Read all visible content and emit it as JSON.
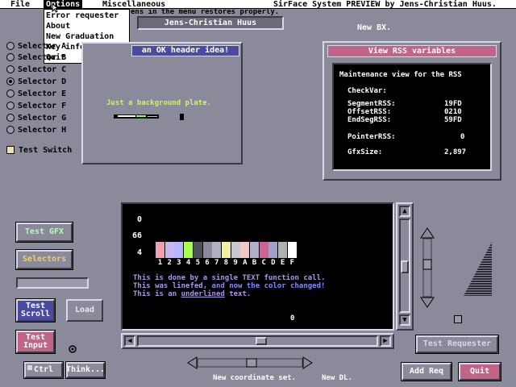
{
  "menubar": {
    "file": "File",
    "options": "Options",
    "misc": "Miscellaneous",
    "title": "SirFace System PREVIEW by Jens-Christian Huus."
  },
  "options_menu": {
    "items": [
      "Error requester",
      "About",
      "New Graduation",
      "Key information",
      "Quit"
    ]
  },
  "hidden_text": "ens in the menu restores properly.",
  "name_banner": "Jens-Christian Huus",
  "new_bx": "New BX.",
  "selectors": [
    {
      "label": "Selector A",
      "selected": false
    },
    {
      "label": "Selector B",
      "selected": false
    },
    {
      "label": "Selector C",
      "selected": false
    },
    {
      "label": "Selector D",
      "selected": true
    },
    {
      "label": "Selector E",
      "selected": false
    },
    {
      "label": "Selector F",
      "selected": false
    },
    {
      "label": "Selector G",
      "selected": false
    },
    {
      "label": "Selector H",
      "selected": false
    }
  ],
  "test_switch": "Test Switch",
  "ok_window": {
    "title": "an OK header idea!",
    "text": "Just a background plate."
  },
  "rss_window": {
    "title": "View RSS variables",
    "heading": "Maintenance view for the RSS",
    "checkvar": "CheckVar:",
    "rows": [
      {
        "label": "SegmentRSS:",
        "value": "19FD"
      },
      {
        "label": "OffsetRSS:",
        "value": "0210"
      },
      {
        "label": "EndSegRSS:",
        "value": "59FD"
      },
      {
        "label": "PointerRSS:",
        "value": "0"
      },
      {
        "label": "GfxSize:",
        "value": "2,897"
      }
    ]
  },
  "buttons": {
    "test_gfx": "Test GFX",
    "selectors": "Selectors",
    "test_scroll_1": "Test",
    "test_scroll_2": "Scroll",
    "load": "Load",
    "test_input_1": "Test",
    "test_input_2": "Input",
    "ctrl": "Ctrl",
    "think": "Think...",
    "test_requester": "Test Requester",
    "add_req": "Add Req",
    "quit": "Quit"
  },
  "text_area": {
    "num_0": "0",
    "num_66": "66",
    "num_4": "4",
    "palette_labels": [
      "1",
      "2",
      "3",
      "4",
      "5",
      "6",
      "7",
      "8",
      "9",
      "A",
      "B",
      "C",
      "D",
      "E",
      "F"
    ],
    "palette_colors": [
      "#f0a0b0",
      "#c8b4f0",
      "#b4b4ff",
      "#a8ff50",
      "#50505a",
      "#8a8a9a",
      "#b0b0c0",
      "#f0f0a0",
      "#c8c8d0",
      "#f0c8c8",
      "#b0b0c8",
      "#c86496",
      "#a0a0c8",
      "#b0b0b0",
      "#ffffff"
    ],
    "line1": "This is done by a single TEXT function call.",
    "line2a": "This was linefed,",
    "line2b": " and now the color changed!",
    "line3a": "This is an ",
    "line3b": "underlined",
    "line3c": " text.",
    "zero": "0"
  },
  "status": {
    "new_coord": "New coordinate set.",
    "new_dl": "New DL."
  },
  "colors": {
    "background": "#8a8a9a",
    "ok_title_bg": "#4a4aa0",
    "rss_title_bg": "#c06488",
    "text_green": "#c8ff40",
    "text_lavender": "#a89ae0",
    "quit_bg": "#c06488",
    "test_gfx_fg": "#b4ffb4",
    "selectors_fg": "#f0d060"
  }
}
